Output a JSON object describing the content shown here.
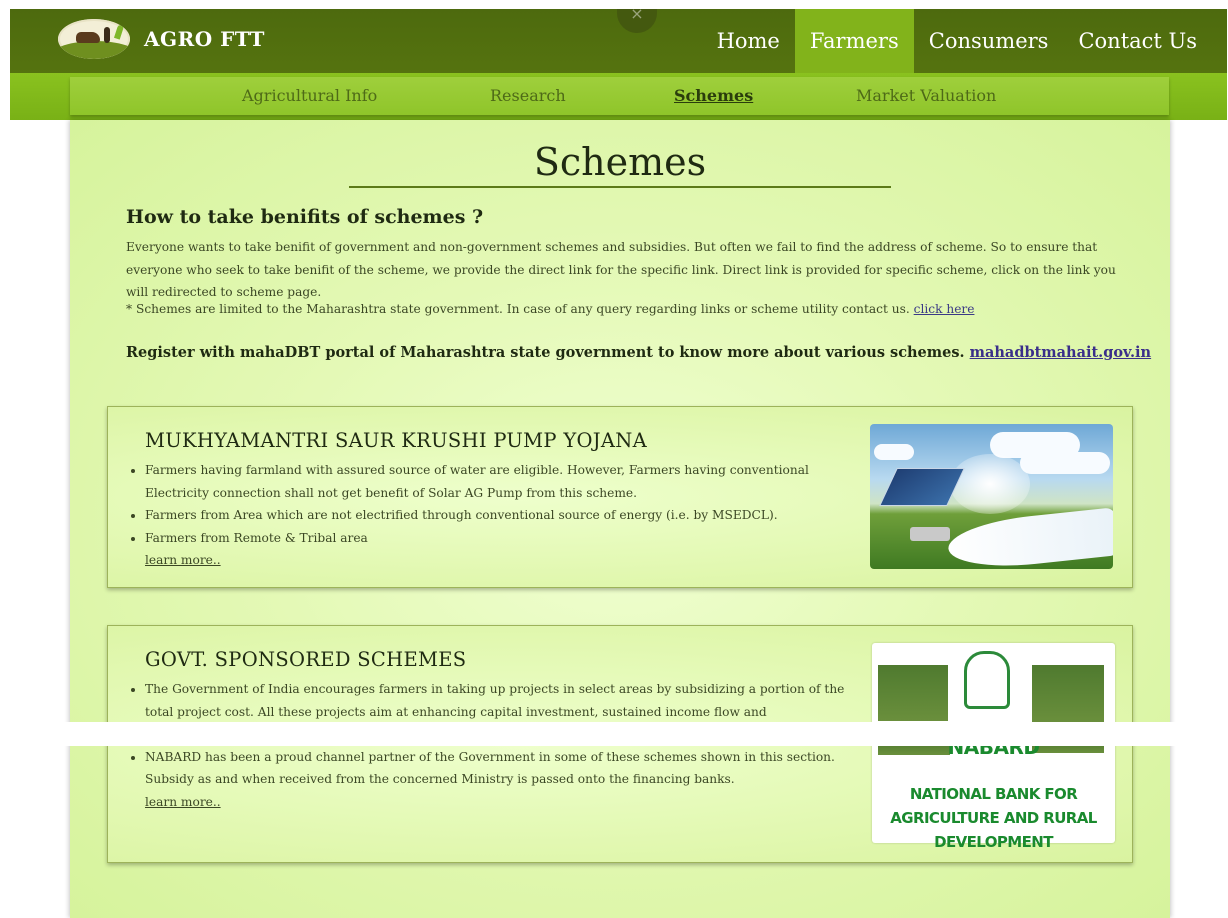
{
  "brand": {
    "name": "AGRO FTT"
  },
  "nav": {
    "items": [
      {
        "label": "Home",
        "active": false
      },
      {
        "label": "Farmers",
        "active": true
      },
      {
        "label": "Consumers",
        "active": false
      },
      {
        "label": "Contact Us",
        "active": false
      }
    ],
    "close_glyph": "×"
  },
  "subnav": {
    "items": [
      {
        "label": "Agricultural Info",
        "active": false
      },
      {
        "label": "Research",
        "active": false
      },
      {
        "label": "Schemes",
        "active": true
      },
      {
        "label": "Market Valuation",
        "active": false
      }
    ]
  },
  "page": {
    "title": "Schemes",
    "howto_heading": "How to take benifits of schemes ?",
    "intro": "Everyone wants to take benifit of government and non-government schemes and subsidies. But often we fail to find the address of scheme. So to ensure that everyone who seek to take benifit of the scheme, we provide the direct link for the specific link. Direct link is provided for specific scheme, click on the link you will redirected to scheme page.",
    "note_text": "* Schemes are limited to the Maharashtra state government. In case of any query regarding links or scheme utility contact us.",
    "note_link": "click here",
    "register_text": "Register with mahaDBT portal of Maharashtra state government to know more about various schemes.",
    "register_link": "mahadbtmahait.gov.in"
  },
  "schemes": [
    {
      "title": "MUKHYAMANTRI SAUR KRUSHI PUMP YOJANA",
      "bullets": [
        "Farmers having farmland with assured source of water are eligible. However, Farmers having conventional Electricity connection shall not get benefit of Solar AG Pump from this scheme.",
        "Farmers from Area which are not electrified through conventional source of energy (i.e. by MSEDCL).",
        "Farmers from Remote & Tribal area"
      ],
      "learn_more": "learn more.."
    },
    {
      "title": "GOVT. SPONSORED SCHEMES",
      "bullets": [
        "The Government of India encourages farmers in taking up projects in select areas by subsidizing a portion of the total project cost. All these projects aim at enhancing capital investment, sustained income flow and employment areas of national importance",
        "NABARD has been a proud channel partner of the Government in some of these schemes shown in this section. Subsidy as and when received from the concerned Ministry is passed onto the financing banks."
      ],
      "learn_more": "learn more..",
      "image_text": {
        "word": "NABARD",
        "full": "NATIONAL BANK FOR AGRICULTURE AND RURAL DEVELOPMENT"
      }
    }
  ],
  "colors": {
    "nav_dark": "#4d6a0e",
    "nav_active": "#82b31b",
    "subnav": "#8fc52a",
    "panel": "#e4f9b6",
    "nabard_green": "#1a8a2e"
  }
}
